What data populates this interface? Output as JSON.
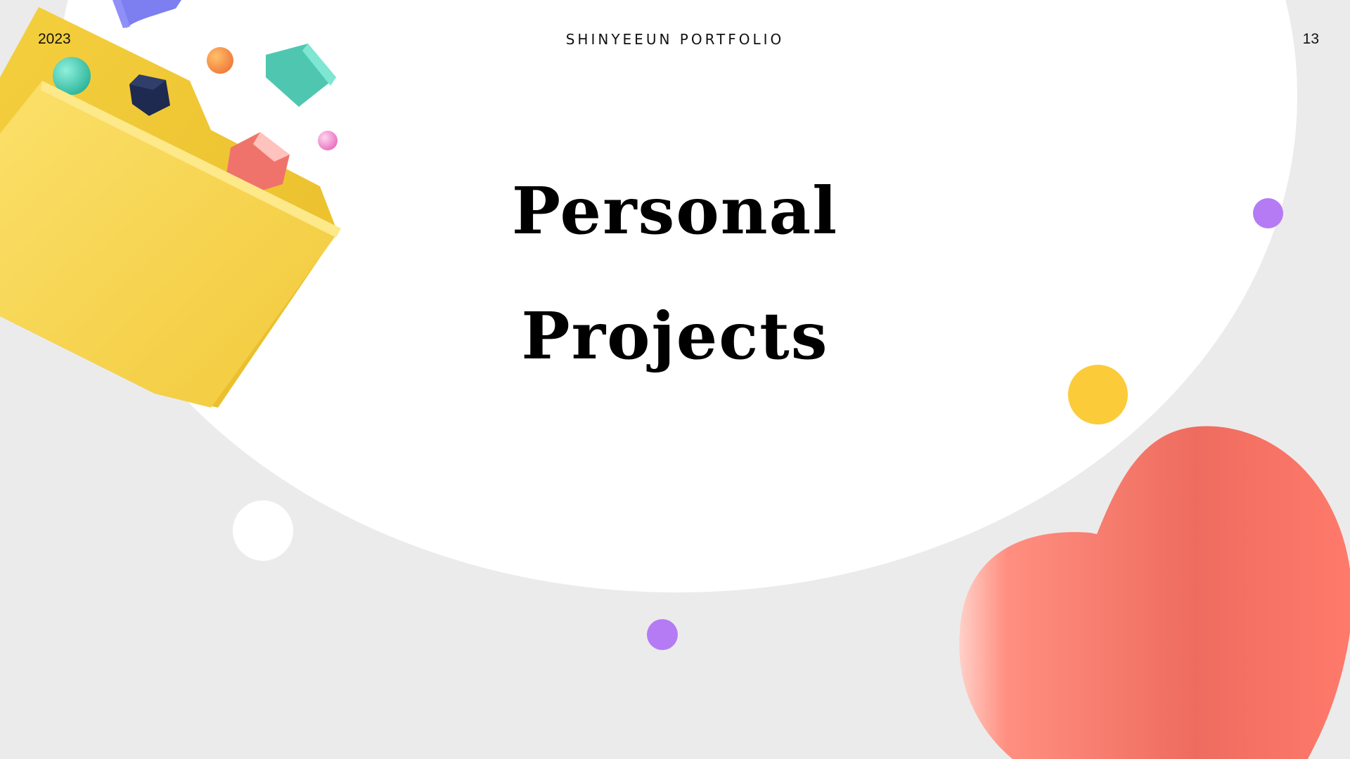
{
  "header": {
    "year": "2023",
    "brand": "SHINYEEUN PORTFOLIO",
    "page_number": "13"
  },
  "title": {
    "line1": "Personal",
    "line2": "Projects"
  },
  "colors": {
    "background": "#ebebeb",
    "circle": "#ffffff",
    "folder": "#f7d14a",
    "heart": "#ff7a6b",
    "purple_dot": "#b57bf5",
    "yellow_dot": "#fccb3a",
    "teal": "#4fc7b0",
    "navy": "#1e2a4f",
    "coral": "#f0736b"
  },
  "icons": {
    "folder": "folder-icon",
    "heart": "heart-icon"
  }
}
